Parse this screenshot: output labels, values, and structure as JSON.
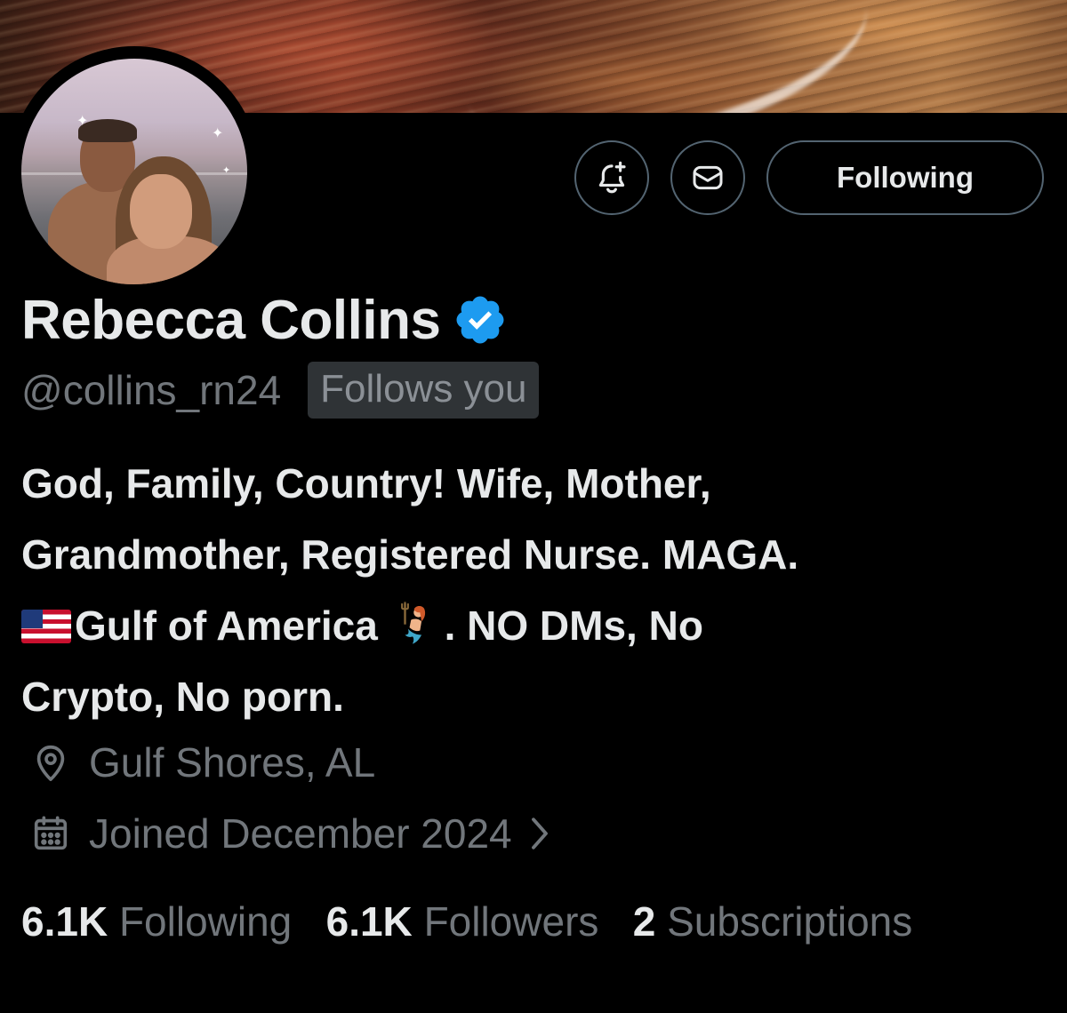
{
  "profile": {
    "name": "Rebecca Collins",
    "handle": "@collins_rn24",
    "follows_you_badge": "Follows you",
    "verified": true,
    "verified_color": "#1d9bf0",
    "bio": {
      "line1": "God, Family, Country! Wife, Mother,",
      "line2": "Grandmother, Registered Nurse. MAGA.",
      "line3_flag_icon": "us-flag-icon",
      "line3_text_a": "Gulf of America",
      "line3_mermaid_icon": "mermaid-icon",
      "line3_text_b": ". NO DMs, No",
      "line4": "Crypto, No porn."
    },
    "location": "Gulf Shores, AL",
    "joined": "Joined December 2024"
  },
  "actions": {
    "notify_icon": "bell-plus-icon",
    "message_icon": "envelope-icon",
    "follow_label": "Following"
  },
  "stats": {
    "following_count": "6.1K",
    "following_label": "Following",
    "followers_count": "6.1K",
    "followers_label": "Followers",
    "subscriptions_count": "2",
    "subscriptions_label": "Subscriptions"
  },
  "colors": {
    "background": "#000000",
    "primary_text": "#e7e9ea",
    "secondary_text": "#71767b",
    "border": "#536471",
    "badge_bg": "#2f3336"
  }
}
